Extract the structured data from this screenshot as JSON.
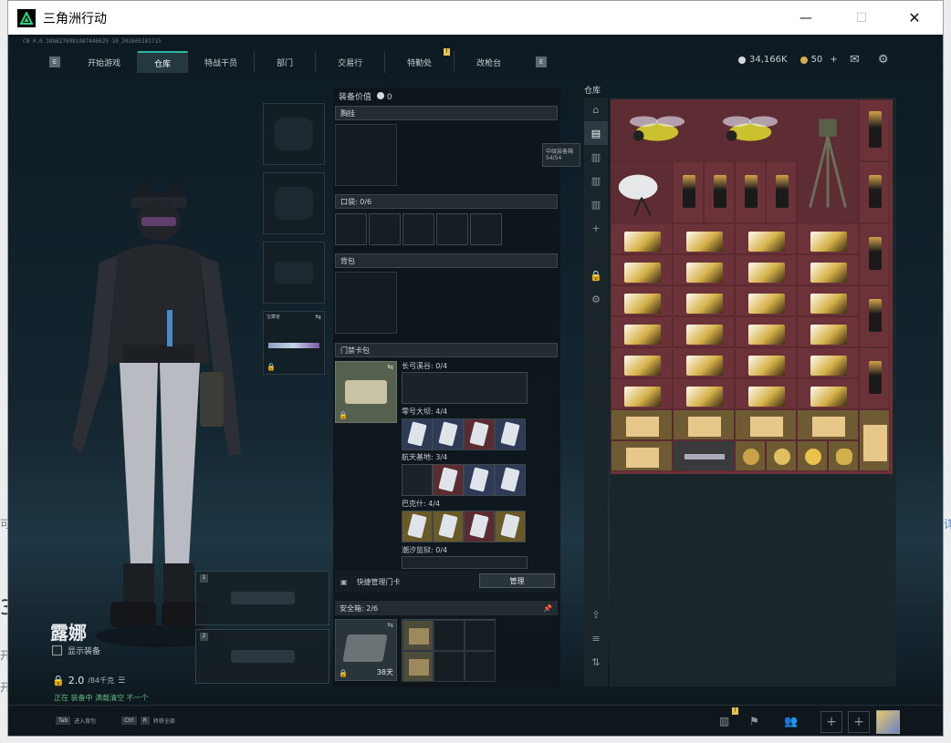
{
  "window": {
    "title": "三角洲行动",
    "min": "—",
    "max": "☐",
    "close": "✕"
  },
  "serial": "CN 0.0.1888276981987446625 10_202605181715",
  "nav": {
    "left_key": "E",
    "right_key": "E",
    "tabs": [
      {
        "label": "开始游戏"
      },
      {
        "label": "仓库"
      },
      {
        "label": "特战干员"
      },
      {
        "label": "部门"
      },
      {
        "label": "交易行"
      },
      {
        "label": "特勤处"
      },
      {
        "label": "改枪台"
      }
    ],
    "alert": "!"
  },
  "currency": {
    "money": "34,166K",
    "coupons": "50",
    "add": "+"
  },
  "character": {
    "name": "露娜",
    "show_gear": "显示装备",
    "weight": "2.0",
    "weight_cap": "/84千克",
    "hint": "正在 装备中 满载清空 不一个"
  },
  "gear_value": {
    "label": "装备价值",
    "value": "0"
  },
  "sections": {
    "chest": "胸挂",
    "pocket": "口袋: 0/6",
    "backpack": "背包",
    "keycard_bag": "门禁卡包"
  },
  "weapon_slot": {
    "label": "宝藏者"
  },
  "keycards": [
    {
      "label": "长弓溪谷: 0/4"
    },
    {
      "label": "零号大坝: 4/4"
    },
    {
      "label": "航天基地: 3/4"
    },
    {
      "label": "巴克什: 4/4"
    },
    {
      "label": "潮汐监狱: 0/4"
    }
  ],
  "quick_manage": {
    "label": "快捷管理门卡",
    "button": "管理"
  },
  "safebox": {
    "label": "安全箱: 2/6",
    "timer": "38天"
  },
  "tooltip": {
    "line1": "中级装备箱",
    "line2": "54/54"
  },
  "warehouse": {
    "title": "仓库"
  },
  "status": {
    "tab_key": "Tab",
    "tab_hint": "进入背包",
    "ctrl_key": "Ctrl",
    "r_key": "R",
    "ctrl_hint": "转移全部",
    "alert": "!"
  },
  "outside": {
    "left": "可",
    "left2": "3",
    "left3": "开",
    "left4": "开",
    "right": "详"
  }
}
